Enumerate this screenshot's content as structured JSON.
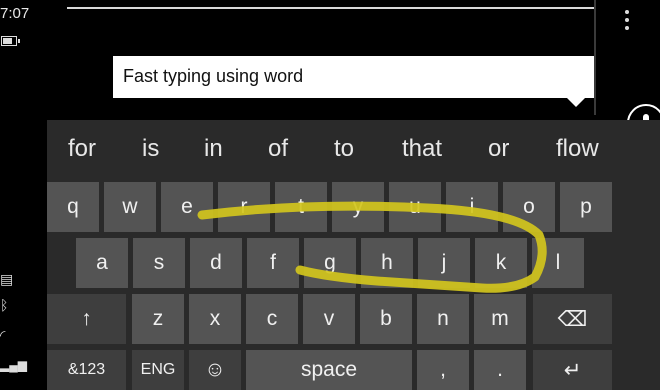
{
  "status": {
    "time": "7:07",
    "icons": [
      "battery-icon",
      "message-icon",
      "bluetooth-icon",
      "wifi-icon",
      "signal-icon"
    ]
  },
  "chat": {
    "message": "Fast typing using word"
  },
  "appbar": {
    "icons": [
      "more-icon",
      "microphone-icon",
      "attach-icon",
      "chat-switch-icon"
    ]
  },
  "keyboard": {
    "suggestions": [
      "for",
      "is",
      "in",
      "of",
      "to",
      "that",
      "or",
      "flow"
    ],
    "row1": [
      "q",
      "w",
      "e",
      "r",
      "t",
      "y",
      "u",
      "i",
      "o",
      "p"
    ],
    "row2": [
      "a",
      "s",
      "d",
      "f",
      "g",
      "h",
      "j",
      "k",
      "l"
    ],
    "row3": [
      "z",
      "x",
      "c",
      "v",
      "b",
      "n",
      "m"
    ],
    "row4": {
      "numbers_label": "&123",
      "language_label": "ENG",
      "emoji_glyph": "☺",
      "space_label": "space",
      "comma_label": ",",
      "period_label": "."
    },
    "shift_glyph": "↑",
    "backspace_glyph": "⌫",
    "enter_glyph": "↵",
    "swipe_color": "#d2c51d"
  }
}
